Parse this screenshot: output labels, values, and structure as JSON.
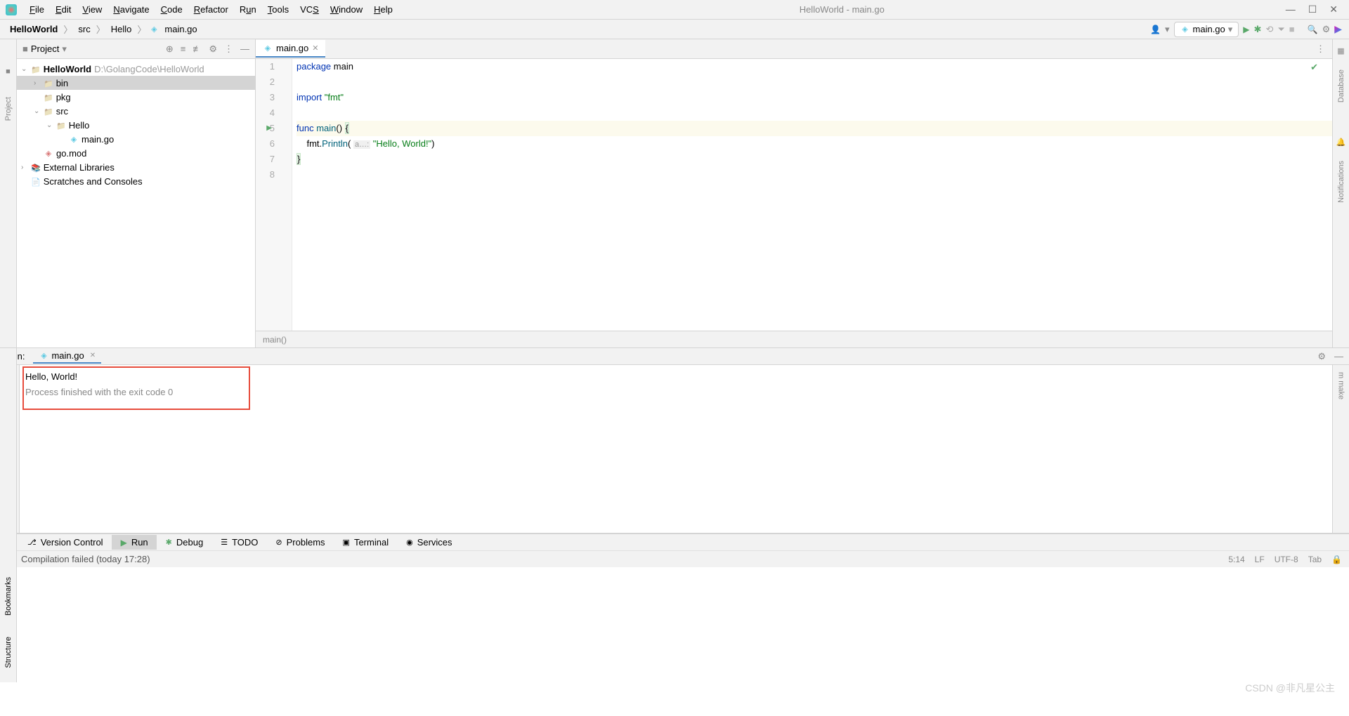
{
  "title": "HelloWorld - main.go",
  "menus": [
    "File",
    "Edit",
    "View",
    "Navigate",
    "Code",
    "Refactor",
    "Run",
    "Tools",
    "VCS",
    "Window",
    "Help"
  ],
  "breadcrumb": [
    "HelloWorld",
    "src",
    "Hello",
    "main.go"
  ],
  "runConfig": "main.go",
  "projectPanel": {
    "title": "Project"
  },
  "tree": {
    "root": "HelloWorld",
    "rootPath": "D:\\GolangCode\\HelloWorld",
    "bin": "bin",
    "pkg": "pkg",
    "src": "src",
    "hello": "Hello",
    "mainfile": "main.go",
    "gomod": "go.mod",
    "extlib": "External Libraries",
    "scratch": "Scratches and Consoles"
  },
  "editorTab": "main.go",
  "code": {
    "l1_kw": "package",
    "l1_pkg": " main",
    "l3_kw": "import",
    "l3_str": " \"fmt\"",
    "l5_kw": "func",
    "l5_fn": " main",
    "l5_paren": "() ",
    "l5_brace": "{",
    "l6_indent": "    ",
    "l6_pkg": "fmt",
    "l6_dot": ".",
    "l6_fn": "Println",
    "l6_open": "( ",
    "l6_hint": "a…:",
    "l6_sp": " ",
    "l6_str": "\"Hello, World!\"",
    "l6_close": ")",
    "l7_brace": "}"
  },
  "lineNums": [
    "1",
    "2",
    "3",
    "4",
    "5",
    "6",
    "7",
    "8"
  ],
  "editorStatus": "main()",
  "runLabel": "Run:",
  "runTab": "main.go",
  "output": {
    "line1": "Hello, World!",
    "line2": "Process finished with the exit code 0"
  },
  "bottomTabs": {
    "vc": "Version Control",
    "run": "Run",
    "debug": "Debug",
    "todo": "TODO",
    "problems": "Problems",
    "terminal": "Terminal",
    "services": "Services"
  },
  "statusBar": {
    "msg": "Compilation failed (today 17:28)",
    "pos": "5:14",
    "le": "LF",
    "enc": "UTF-8",
    "indent": "Tab"
  },
  "leftRail": {
    "project": "Project"
  },
  "rightRail": {
    "database": "Database",
    "notifications": "Notifications"
  },
  "bottomRail": {
    "bookmarks": "Bookmarks",
    "structure": "Structure"
  },
  "watermark": "CSDN @非凡星公主"
}
